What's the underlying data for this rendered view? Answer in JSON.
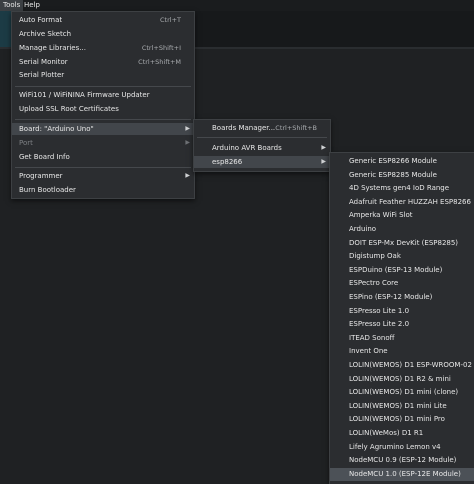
{
  "menubar": {
    "tools": "Tools",
    "help": "Help"
  },
  "tools_menu": {
    "group1": [
      {
        "label": "Auto Format",
        "shortcut": "Ctrl+T"
      },
      {
        "label": "Archive Sketch",
        "shortcut": ""
      },
      {
        "label": "Manage Libraries...",
        "shortcut": "Ctrl+Shift+I"
      },
      {
        "label": "Serial Monitor",
        "shortcut": "Ctrl+Shift+M"
      },
      {
        "label": "Serial Plotter",
        "shortcut": ""
      }
    ],
    "group2": [
      {
        "label": "WiFi101 / WiFiNINA Firmware Updater"
      },
      {
        "label": "Upload SSL Root Certificates"
      }
    ],
    "group3": [
      {
        "label": "Board: \"Arduino Uno\""
      },
      {
        "label": "Port"
      },
      {
        "label": "Get Board Info"
      }
    ],
    "group4": [
      {
        "label": "Programmer"
      },
      {
        "label": "Burn Bootloader"
      }
    ]
  },
  "board_menu": {
    "boards_manager": {
      "label": "Boards Manager...",
      "shortcut": "Ctrl+Shift+B"
    },
    "items": [
      {
        "label": "Arduino AVR Boards"
      },
      {
        "label": "esp8266"
      }
    ]
  },
  "esp8266_menu": {
    "items": [
      "Generic ESP8266 Module",
      "Generic ESP8285 Module",
      "4D Systems gen4 IoD Range",
      "Adafruit Feather HUZZAH ESP8266",
      "Amperka WiFi Slot",
      "Arduino",
      "DOIT ESP-Mx DevKit (ESP8285)",
      "Digistump Oak",
      "ESPDuino (ESP-13 Module)",
      "ESPectro Core",
      "ESPino (ESP-12 Module)",
      "ESPresso Lite 1.0",
      "ESPresso Lite 2.0",
      "ITEAD Sonoff",
      "Invent One",
      "LOLIN(WEMOS) D1 ESP-WROOM-02",
      "LOLIN(WEMOS) D1 R2 & mini",
      "LOLIN(WEMOS) D1 mini (clone)",
      "LOLIN(WEMOS) D1 mini Lite",
      "LOLIN(WEMOS) D1 mini Pro",
      "LOLIN(WeMos) D1 R1",
      "Lifely Agrumino Lemon v4",
      "NodeMCU 0.9 (ESP-12 Module)",
      "NodeMCU 1.0 (ESP-12E Module)"
    ]
  },
  "icons": {
    "submenu_arrow": "chevron-right-icon"
  },
  "colors": {
    "menu_bg": "#2b2d30",
    "highlight": "#42464b",
    "selected": "#4c5157",
    "editor_tab": "#1c3b45"
  }
}
